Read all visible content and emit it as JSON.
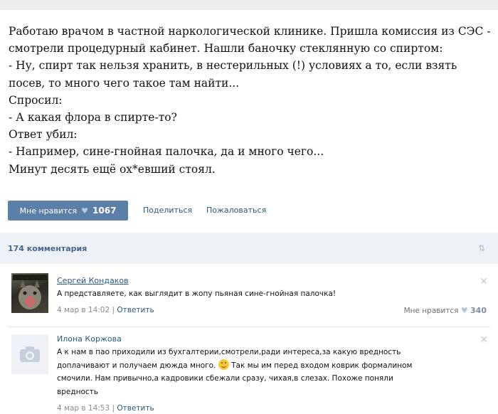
{
  "post": {
    "lines": [
      "Работаю врачом в частной наркологической клинике. Пришла комиссия из СЭС -",
      "смотрели процедурный кабинет. Нашли баночку стеклянную со спиртом:",
      "- Ну, спирт так нельзя хранить, в нестерильных (!) условиях а то, если взять",
      "посев, то много чего такое там найти...",
      "Спросил:",
      "- А какая флора в спирте-то?",
      "Ответ убил:",
      "- Например, сине-гнойная палочка, да и много чего...",
      "Минут десять ещё ох*евший стоял."
    ]
  },
  "actions": {
    "like_label": "Мне нравится",
    "like_count": "1067",
    "share_label": "Поделиться",
    "report_label": "Пожаловаться"
  },
  "comments_bar": {
    "count_label": "174 комментария",
    "sort_icon": "sort-arrows-icon"
  },
  "comments": [
    {
      "author": "Сергей Кондаков",
      "text_lines": [
        "А представляете, как выглядит в жопу пьяная сине-гнойная палочка!"
      ],
      "date": "4 мар в 14:02",
      "reply_label": "Ответить",
      "like_label": "Мне нравится",
      "like_count": "340"
    },
    {
      "author": "Илона Коржова",
      "text_lines": [
        "А к нам в пао приходили из бухгалтерии,смотрели,ради интереса,за какую вредность",
        "доплачивают и получаем дюжда много.",
        "смочили. Нам привычно,а кадровики сбежали сразу, чихая,в слезах. Похоже поняли",
        "вредность"
      ],
      "text_line2_after_smile": "Так мы им перед входом коврик формалином",
      "date": "4 мар в 14:53",
      "reply_label": "Ответить"
    }
  ],
  "colors": {
    "like_button": "#5b7fa6",
    "link": "#2b587a",
    "comments_bar": "#edf0f4"
  }
}
